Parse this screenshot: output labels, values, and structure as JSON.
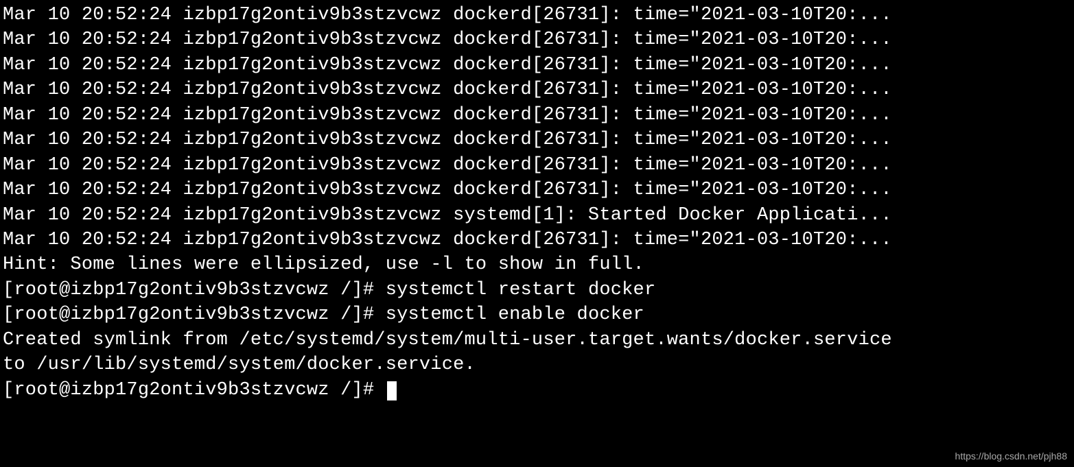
{
  "terminal": {
    "watermark": "https://blog.csdn.net/pjh88",
    "logs": [
      "Mar 10 20:52:24 izbp17g2ontiv9b3stzvcwz dockerd[26731]: time=\"2021-03-10T20:...",
      "Mar 10 20:52:24 izbp17g2ontiv9b3stzvcwz dockerd[26731]: time=\"2021-03-10T20:...",
      "Mar 10 20:52:24 izbp17g2ontiv9b3stzvcwz dockerd[26731]: time=\"2021-03-10T20:...",
      "Mar 10 20:52:24 izbp17g2ontiv9b3stzvcwz dockerd[26731]: time=\"2021-03-10T20:...",
      "Mar 10 20:52:24 izbp17g2ontiv9b3stzvcwz dockerd[26731]: time=\"2021-03-10T20:...",
      "Mar 10 20:52:24 izbp17g2ontiv9b3stzvcwz dockerd[26731]: time=\"2021-03-10T20:...",
      "Mar 10 20:52:24 izbp17g2ontiv9b3stzvcwz dockerd[26731]: time=\"2021-03-10T20:...",
      "Mar 10 20:52:24 izbp17g2ontiv9b3stzvcwz dockerd[26731]: time=\"2021-03-10T20:...",
      "Mar 10 20:52:24 izbp17g2ontiv9b3stzvcwz systemd[1]: Started Docker Applicati...",
      "Mar 10 20:52:24 izbp17g2ontiv9b3stzvcwz dockerd[26731]: time=\"2021-03-10T20:..."
    ],
    "hint": "Hint: Some lines were ellipsized, use -l to show in full.",
    "prompt1_prefix": "[root@izbp17g2ontiv9b3stzvcwz /]# ",
    "command1": "systemctl restart docker",
    "prompt2_prefix": "[root@izbp17g2ontiv9b3stzvcwz /]# ",
    "command2": "systemctl enable docker",
    "output_line1": "Created symlink from /etc/systemd/system/multi-user.target.wants/docker.service",
    "output_line2": " to /usr/lib/systemd/system/docker.service.",
    "prompt3": "[root@izbp17g2ontiv9b3stzvcwz /]# "
  }
}
